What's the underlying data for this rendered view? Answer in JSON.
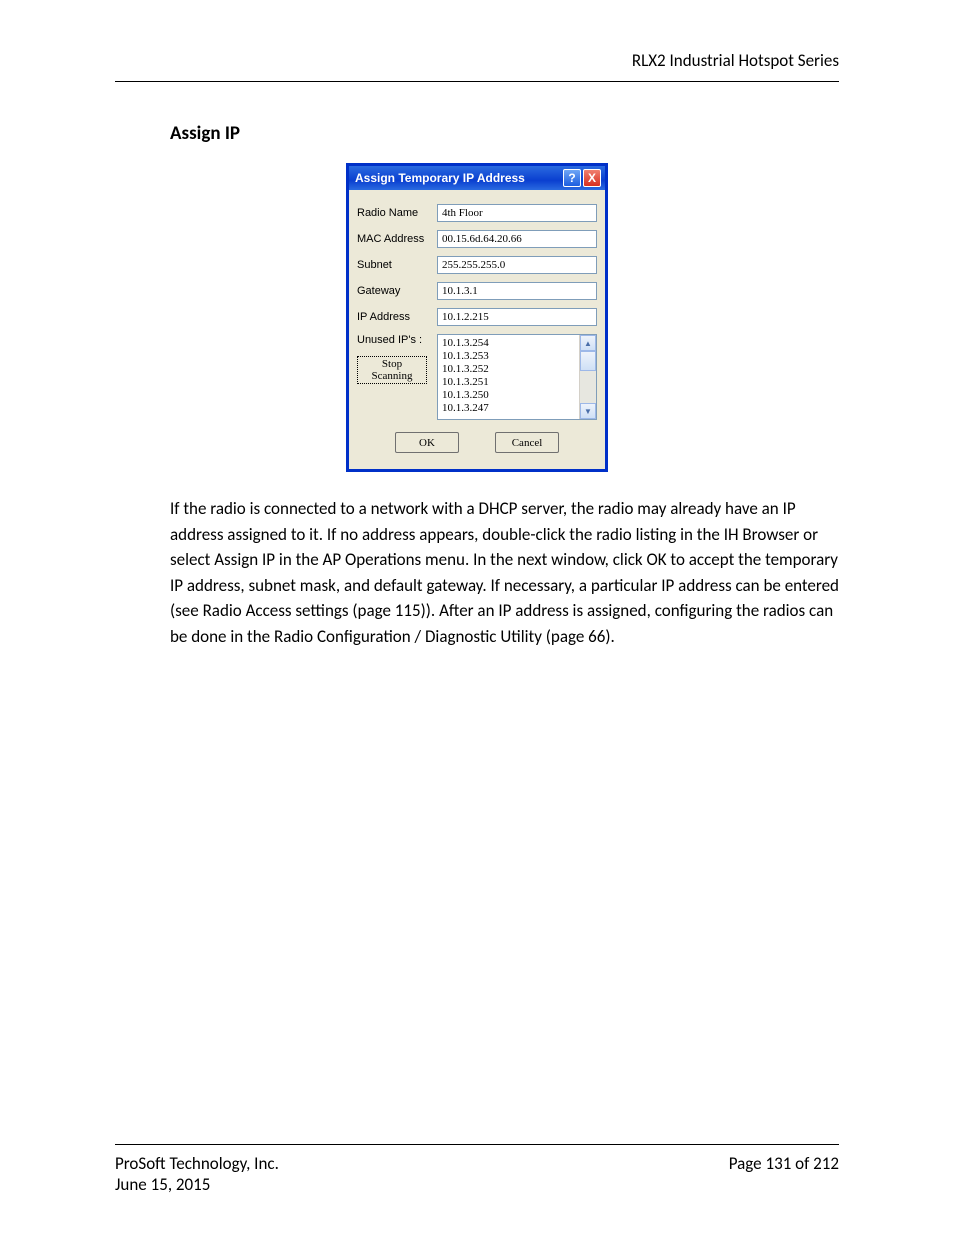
{
  "header": {
    "running_title": "RLX2 Industrial Hotspot Series"
  },
  "section": {
    "title": "Assign IP"
  },
  "dialog": {
    "title": "Assign Temporary IP Address",
    "help_glyph": "?",
    "close_glyph": "X",
    "labels": {
      "radio_name": "Radio Name",
      "mac_address": "MAC Address",
      "subnet": "Subnet",
      "gateway": "Gateway",
      "ip_address": "IP Address",
      "unused_ips": "Unused IP's :"
    },
    "values": {
      "radio_name": "4th Floor",
      "mac_address": "00.15.6d.64.20.66",
      "subnet": "255.255.255.0",
      "gateway": "10.1.3.1",
      "ip_address": "10.1.2.215"
    },
    "unused_ips": [
      "10.1.3.254",
      "10.1.3.253",
      "10.1.3.252",
      "10.1.3.251",
      "10.1.3.250",
      "10.1.3.247"
    ],
    "stop_scanning_label": "Stop Scanning",
    "ok_label": "OK",
    "cancel_label": "Cancel",
    "scroll": {
      "up": "▲",
      "down": "▼"
    }
  },
  "paragraph": "If the radio is connected to a network with a DHCP server, the radio may already have an IP address assigned to it. If no address appears, double-click the radio listing in the IH Browser or select Assign IP in the AP Operations menu. In the next window, click OK to accept the temporary IP address, subnet mask, and default gateway. If necessary, a particular IP address can be entered (see Radio Access settings (page 115)). After an IP address is assigned, configuring the radios can be done in the Radio Configuration / Diagnostic Utility (page 66).",
  "footer": {
    "company": "ProSoft Technology, Inc.",
    "date": "June 15, 2015",
    "page": "Page 131 of 212"
  }
}
